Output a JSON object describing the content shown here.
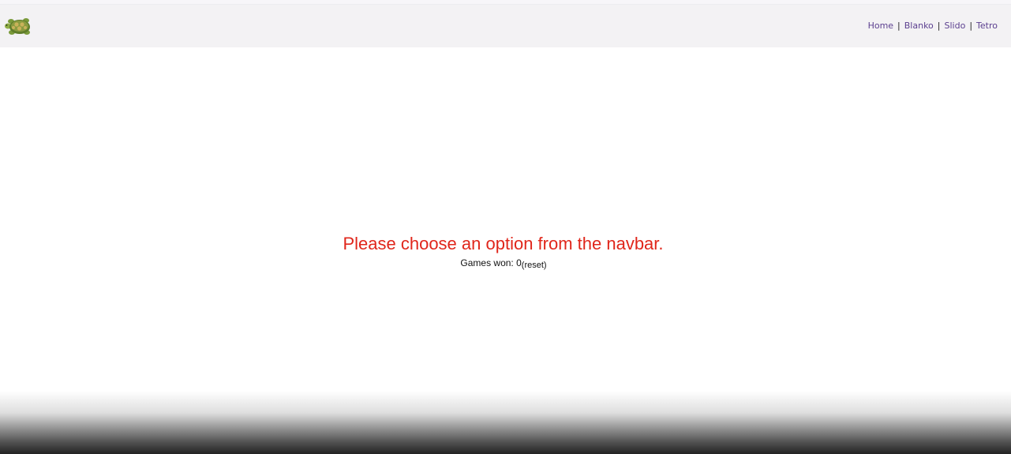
{
  "navbar": {
    "logo_icon": "turtle-logo-icon",
    "links": [
      {
        "label": "Home"
      },
      {
        "label": "Blanko"
      },
      {
        "label": "Slido"
      },
      {
        "label": "Tetro"
      }
    ],
    "separator": "|",
    "link_color": "#5b3f8f",
    "background": "#f3f2f4"
  },
  "main": {
    "message": "Please choose an option from the navbar.",
    "message_color": "#e0261b",
    "games_won_label": "Games won: ",
    "games_won_count": "0",
    "reset_label": "(reset)"
  }
}
